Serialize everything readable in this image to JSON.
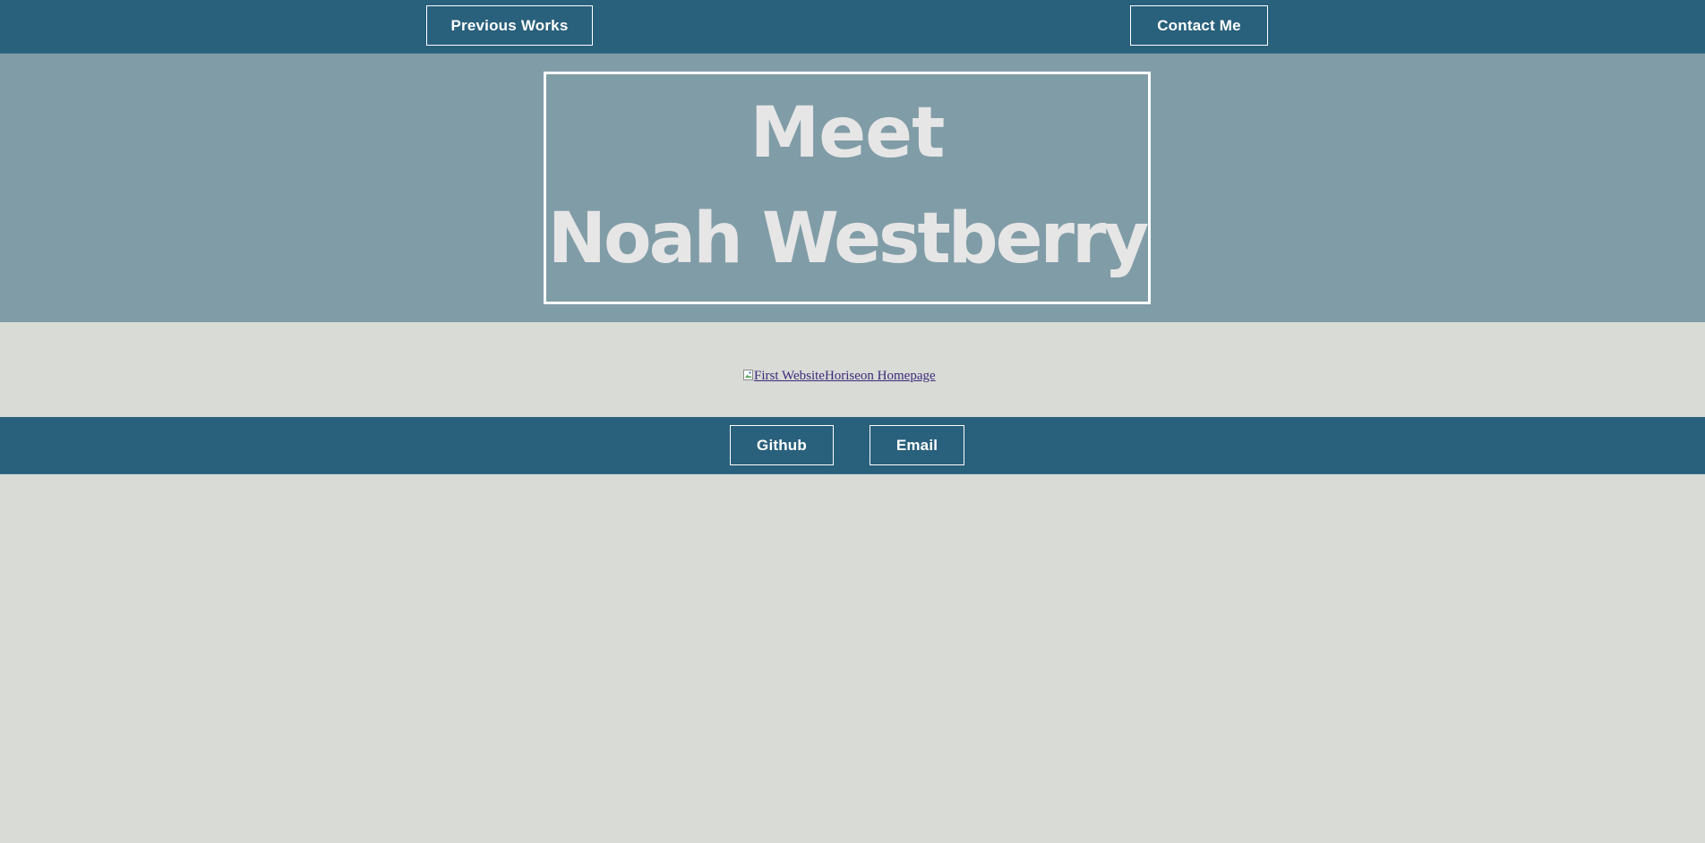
{
  "nav": {
    "previous_works": "Previous Works",
    "contact_me": "Contact Me"
  },
  "hero": {
    "line1": "Meet",
    "line2": "Noah Westberry"
  },
  "works": {
    "link1_alt": "First Website",
    "link2_alt": "Horiseon Homepage"
  },
  "footer": {
    "github": "Github",
    "email": "Email"
  },
  "colors": {
    "nav_bg": "#29607c",
    "hero_bg": "#809ca7",
    "page_bg": "#d9dbd6",
    "hero_text": "#e6e6e6",
    "link": "#3b2a7a"
  },
  "icons": {
    "broken_image": "broken-image-icon"
  }
}
